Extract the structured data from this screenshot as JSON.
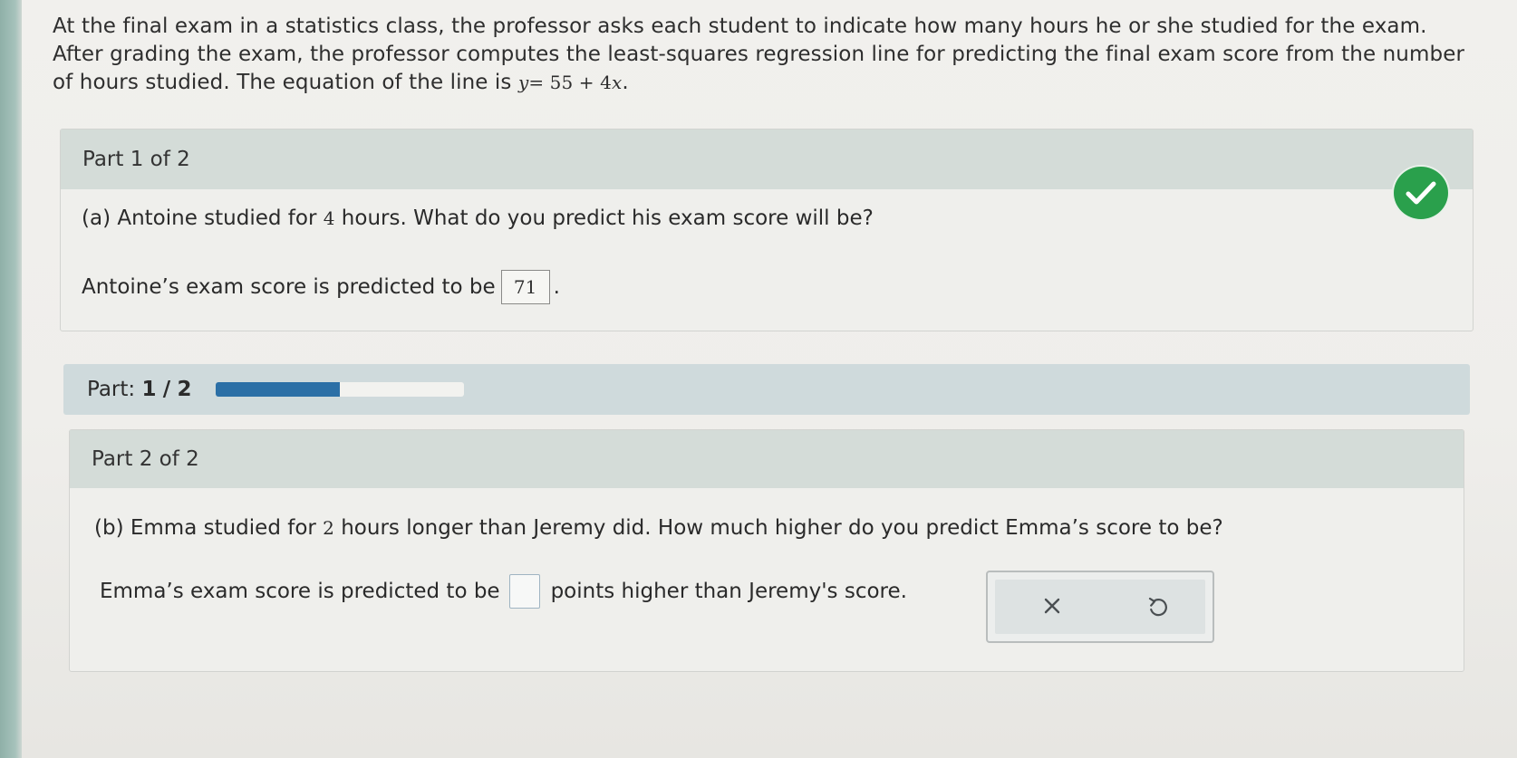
{
  "problem": {
    "text": "At the final exam in a statistics class, the professor asks each student to indicate how many hours he or she studied for the exam. After grading the exam, the professor computes the least-squares regression line for predicting the final exam score from the number of hours studied. The equation of the line is",
    "equation_y": "y",
    "equation_eq": "=",
    "equation_const": "55",
    "equation_plus": "+",
    "equation_coef": "4",
    "equation_x": "x",
    "equation_end": "."
  },
  "part1": {
    "header": "Part 1 of 2",
    "question_prefix": "(a) Antoine studied for",
    "question_number": "4",
    "question_suffix": "hours. What do you predict his exam score will be?",
    "answer_prefix": "Antoine’s exam score is predicted to be",
    "answer_value": "71",
    "answer_suffix": ".",
    "status_icon": "checkmark-icon",
    "status_color": "#2aa04c"
  },
  "progress": {
    "label": "Part:",
    "current": "1",
    "separator": "/",
    "total": "2",
    "fraction": 0.5,
    "fill_color": "#2b6fa6"
  },
  "part2": {
    "header": "Part 2 of 2",
    "question_prefix": "(b) Emma studied for",
    "question_number": "2",
    "question_suffix": "hours longer than Jeremy did. How much higher do you predict Emma’s score to be?",
    "answer_prefix": "Emma’s exam score is predicted to be",
    "answer_value": "",
    "answer_suffix": "points higher than Jeremy's score."
  },
  "tools": {
    "clear_icon": "x-icon",
    "undo_icon": "undo-icon"
  }
}
